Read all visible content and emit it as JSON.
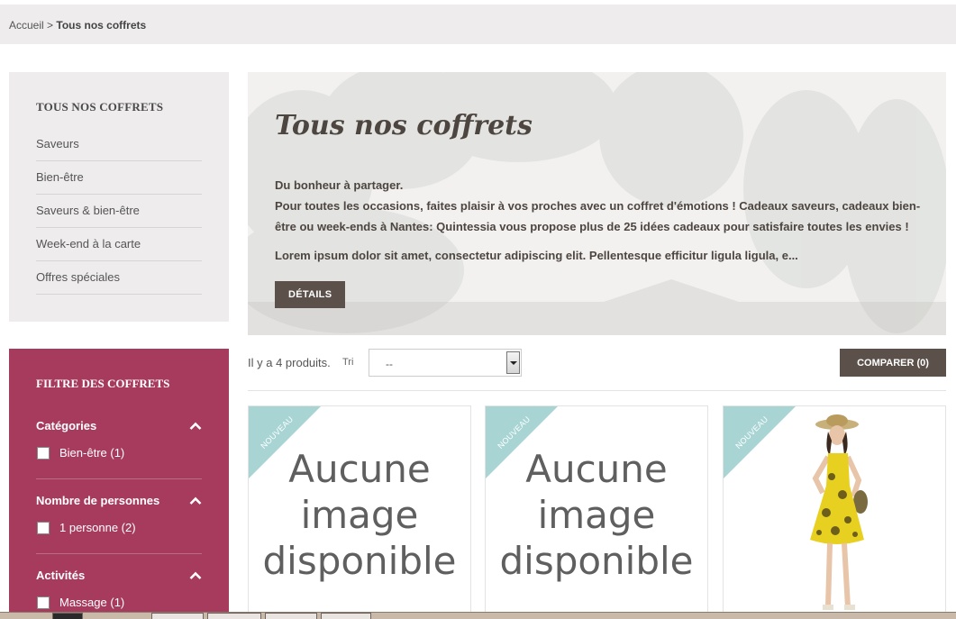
{
  "breadcrumb": {
    "home": "Accueil",
    "separator": " > ",
    "current": "Tous nos coffrets"
  },
  "sidebar": {
    "title": "TOUS NOS COFFRETS",
    "items": [
      {
        "label": "Saveurs"
      },
      {
        "label": "Bien-être"
      },
      {
        "label": "Saveurs & bien-être"
      },
      {
        "label": "Week-end à la carte"
      },
      {
        "label": "Offres spéciales"
      }
    ]
  },
  "filter": {
    "title": "FILTRE DES COFFRETS",
    "groups": [
      {
        "label": "Catégories",
        "option": "Bien-être (1)"
      },
      {
        "label": "Nombre de personnes",
        "option": "1 personne (2)"
      },
      {
        "label": "Activités",
        "option": "Massage (1)"
      }
    ]
  },
  "hero": {
    "title": "Tous nos coffrets",
    "line1": "Du bonheur à partager.",
    "line2": "Pour toutes les occasions, faites plaisir à vos proches avec un coffret d'émotions ! Cadeaux saveurs, cadeaux bien-être ou week-ends à Nantes: Quintessia vous propose plus de 25 idées cadeaux pour satisfaire toutes les envies !",
    "lorem": "Lorem ipsum dolor sit amet, consectetur adipiscing elit. Pellentesque efficitur ligula ligula, e...",
    "details_label": "DÉTAILS"
  },
  "toolbar": {
    "count": "Il y a 4 produits.",
    "sort_label": "Tri",
    "sort_value": "--",
    "compare_label": "COMPARER (0)"
  },
  "products": [
    {
      "badge": "NOUVEAU",
      "noimage_text": "Aucune image disponible"
    },
    {
      "badge": "NOUVEAU",
      "noimage_text": "Aucune image disponible"
    },
    {
      "badge": "NOUVEAU",
      "image": "woman-yellow-dress-photo"
    }
  ],
  "colors": {
    "filter_bg": "#a63b5e",
    "button_bg": "#5b504a",
    "ribbon": "#a8d4d4",
    "panel_bg": "#eeecec"
  }
}
